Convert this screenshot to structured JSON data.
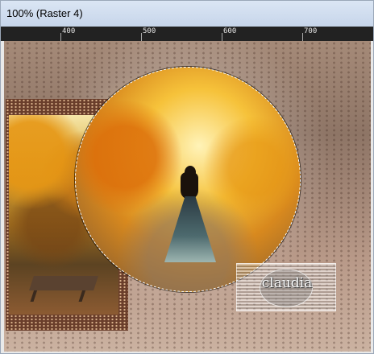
{
  "window": {
    "title": "100% (Raster 4)"
  },
  "ruler": {
    "labels": [
      "400",
      "500",
      "600",
      "700"
    ]
  },
  "canvas": {
    "watermark_text": "claudia"
  },
  "colors": {
    "titlebar": "#c6d5ea",
    "ruler_bg": "#222222",
    "canvas_bg": "#a58a78",
    "selection_marquee": "#ffffff"
  },
  "icons": {
    "selection": "dashed-circle-selection"
  }
}
